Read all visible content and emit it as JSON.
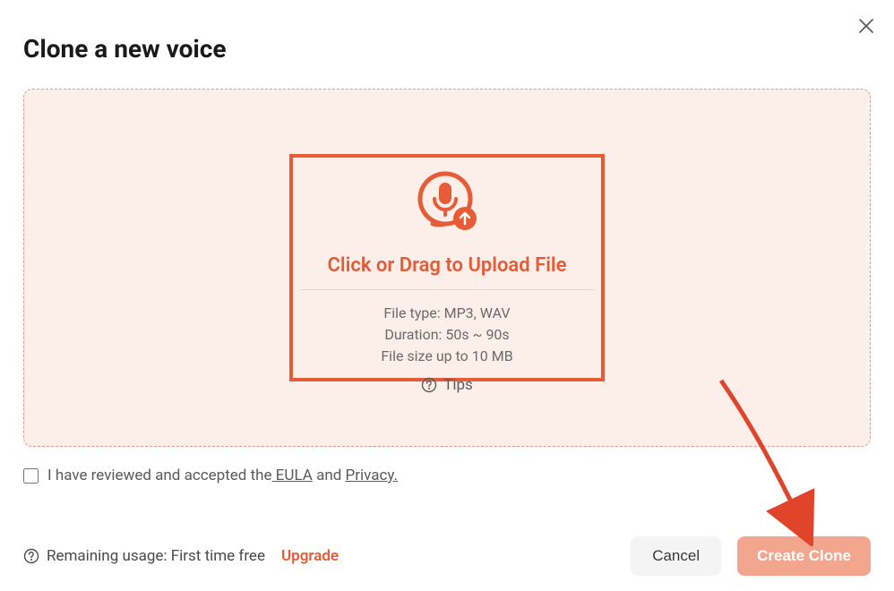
{
  "modal": {
    "title": "Clone a new voice"
  },
  "dropzone": {
    "upload_label": "Click or Drag to Upload File",
    "file_type": "File type: MP3, WAV",
    "duration": "Duration: 50s ~ 90s",
    "size_limit": "File size up to 10 MB",
    "tips_label": "Tips"
  },
  "consent": {
    "prefix": "I have reviewed and accepted the",
    "eula_label": " EULA",
    "middle": " and ",
    "privacy_label": "Privacy."
  },
  "footer": {
    "usage_label": "Remaining usage: First time free",
    "upgrade_label": "Upgrade",
    "cancel_label": "Cancel",
    "create_label": "Create Clone"
  }
}
